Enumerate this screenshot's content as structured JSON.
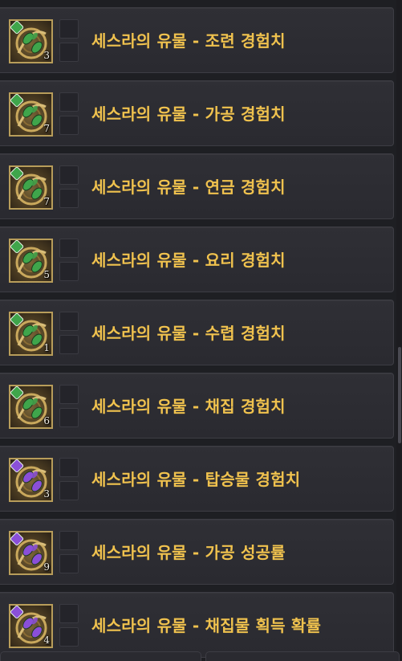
{
  "items": [
    {
      "label": "세스라의 유물 - 조련 경험치",
      "count": "3",
      "tier": "green",
      "gem": "#3fa54b"
    },
    {
      "label": "세스라의 유물 - 가공 경험치",
      "count": "7",
      "tier": "green",
      "gem": "#3fa54b"
    },
    {
      "label": "세스라의 유물 - 연금 경험치",
      "count": "7",
      "tier": "green",
      "gem": "#3fa54b"
    },
    {
      "label": "세스라의 유물 - 요리 경험치",
      "count": "5",
      "tier": "green",
      "gem": "#3fa54b"
    },
    {
      "label": "세스라의 유물 - 수렵 경험치",
      "count": "1",
      "tier": "green",
      "gem": "#3fa54b"
    },
    {
      "label": "세스라의 유물 - 채집 경험치",
      "count": "6",
      "tier": "green",
      "gem": "#3fa54b"
    },
    {
      "label": "세스라의 유물 - 탑승물 경험치",
      "count": "3",
      "tier": "purple",
      "gem": "#8a4fd8"
    },
    {
      "label": "세스라의 유물 - 가공 성공률",
      "count": "9",
      "tier": "purple",
      "gem": "#8a4fd8"
    },
    {
      "label": "세스라의 유물 - 채집물 획득 확률",
      "count": "4",
      "tier": "purple",
      "gem": "#8a4fd8"
    }
  ],
  "icon_name": "sesra-relic-icon",
  "colors": {
    "label": "#f0c24e",
    "row_bg": "#2e2e34",
    "frame": "#b89d5a"
  }
}
